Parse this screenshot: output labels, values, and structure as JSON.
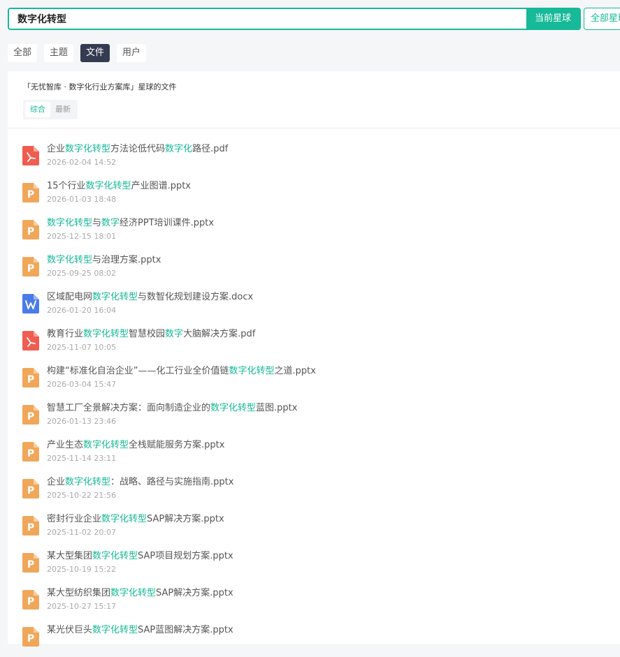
{
  "search": {
    "value": "数字化转型",
    "current_label": "当前星球",
    "all_label": "全部星球"
  },
  "tabs": [
    {
      "label": "全部",
      "active": false
    },
    {
      "label": "主题",
      "active": false
    },
    {
      "label": "文件",
      "active": true
    },
    {
      "label": "用户",
      "active": false
    }
  ],
  "panel": {
    "title": "「无忧智库 · 数字化行业方案库」星球的文件",
    "sort": [
      {
        "label": "综合",
        "active": true
      },
      {
        "label": "最新",
        "active": false
      }
    ]
  },
  "colors": {
    "accent": "#16b998",
    "pdf": "#ef5d51",
    "pptx": "#f0a75a",
    "docx": "#4a7ce8"
  },
  "files": [
    {
      "type": "pdf",
      "icon": "pdf-file-icon",
      "name_parts": [
        [
          "企业",
          false
        ],
        [
          "数字化转型",
          true
        ],
        [
          "方法论低代码",
          false
        ],
        [
          "数字化",
          true
        ],
        [
          "路径.pdf",
          false
        ]
      ],
      "date": "2026-02-04 14:52"
    },
    {
      "type": "pptx",
      "icon": "pptx-file-icon",
      "name_parts": [
        [
          "15个行业",
          false
        ],
        [
          "数字化转型",
          true
        ],
        [
          "产业图谱.pptx",
          false
        ]
      ],
      "date": "2026-01-03 18:48"
    },
    {
      "type": "pptx",
      "icon": "pptx-file-icon",
      "name_parts": [
        [
          "数字化转型",
          true
        ],
        [
          "与",
          false
        ],
        [
          "数字",
          true
        ],
        [
          "经济PPT培训课件.pptx",
          false
        ]
      ],
      "date": "2025-12-15 18:01"
    },
    {
      "type": "pptx",
      "icon": "pptx-file-icon",
      "name_parts": [
        [
          "数字化转型",
          true
        ],
        [
          "与治理方案.pptx",
          false
        ]
      ],
      "date": "2025-09-25 08:02"
    },
    {
      "type": "docx",
      "icon": "docx-file-icon",
      "name_parts": [
        [
          "区域配电网",
          false
        ],
        [
          "数字化转型",
          true
        ],
        [
          "与数智化规划建设方案.docx",
          false
        ]
      ],
      "date": "2026-01-20 16:04"
    },
    {
      "type": "pdf",
      "icon": "pdf-file-icon",
      "name_parts": [
        [
          "教育行业",
          false
        ],
        [
          "数字化转型",
          true
        ],
        [
          "智慧校园",
          false
        ],
        [
          "数字",
          true
        ],
        [
          "大脑解决方案.pdf",
          false
        ]
      ],
      "date": "2025-11-07 10:05"
    },
    {
      "type": "pptx",
      "icon": "pptx-file-icon",
      "name_parts": [
        [
          "构建“标准化自治企业”——化工行业全价值链",
          false
        ],
        [
          "数字化转型",
          true
        ],
        [
          "之道.pptx",
          false
        ]
      ],
      "date": "2026-03-04 15:47"
    },
    {
      "type": "pptx",
      "icon": "pptx-file-icon",
      "name_parts": [
        [
          "智慧工厂全景解决方案：面向制造企业的",
          false
        ],
        [
          "数字化转型",
          true
        ],
        [
          "蓝图.pptx",
          false
        ]
      ],
      "date": "2026-01-13 23:46"
    },
    {
      "type": "pptx",
      "icon": "pptx-file-icon",
      "name_parts": [
        [
          "产业生态",
          false
        ],
        [
          "数字化转型",
          true
        ],
        [
          "全栈赋能服务方案.pptx",
          false
        ]
      ],
      "date": "2025-11-14 23:11"
    },
    {
      "type": "pptx",
      "icon": "pptx-file-icon",
      "name_parts": [
        [
          "企业",
          false
        ],
        [
          "数字化转型",
          true
        ],
        [
          "：战略、路径与实施指南.pptx",
          false
        ]
      ],
      "date": "2025-10-22 21:56"
    },
    {
      "type": "pptx",
      "icon": "pptx-file-icon",
      "name_parts": [
        [
          "密封行业企业",
          false
        ],
        [
          "数字化转型",
          true
        ],
        [
          "SAP解决方案.pptx",
          false
        ]
      ],
      "date": "2025-11-02 20:07"
    },
    {
      "type": "pptx",
      "icon": "pptx-file-icon",
      "name_parts": [
        [
          "某大型集团",
          false
        ],
        [
          "数字化转型",
          true
        ],
        [
          "SAP项目规划方案.pptx",
          false
        ]
      ],
      "date": "2025-10-19 15:22"
    },
    {
      "type": "pptx",
      "icon": "pptx-file-icon",
      "name_parts": [
        [
          "某大型纺织集团",
          false
        ],
        [
          "数字化转型",
          true
        ],
        [
          "SAP解决方案.pptx",
          false
        ]
      ],
      "date": "2025-10-27 15:17"
    },
    {
      "type": "pptx",
      "icon": "pptx-file-icon",
      "name_parts": [
        [
          "某光伏巨头",
          false
        ],
        [
          "数字化转型",
          true
        ],
        [
          "SAP蓝图解决方案.pptx",
          false
        ]
      ],
      "date": ""
    }
  ]
}
